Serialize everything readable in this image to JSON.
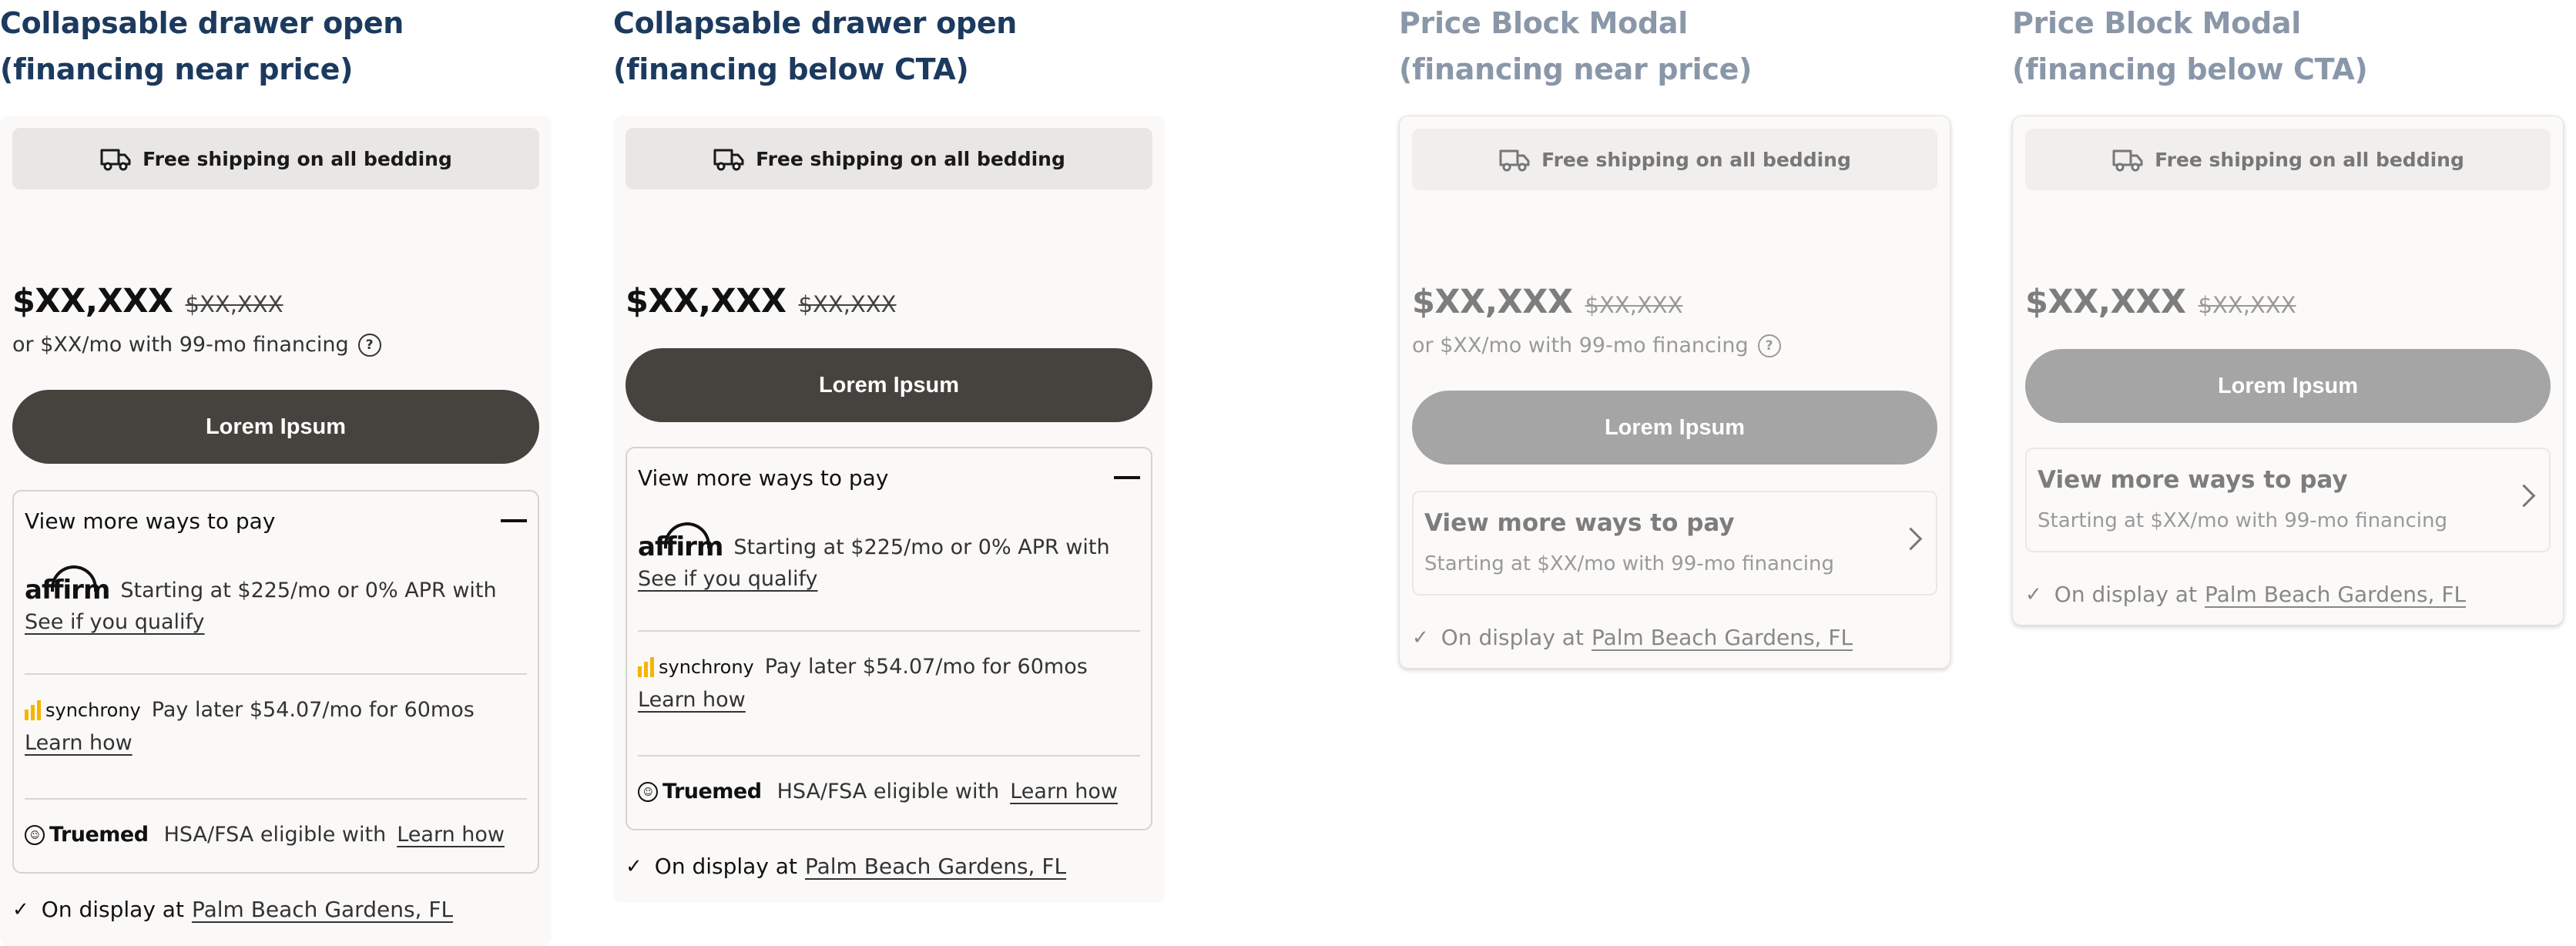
{
  "colors": {
    "title": "#1c3a5e",
    "title_dim": "#8a97a8",
    "cta": "#46433e",
    "cta_dim": "#a5a5a5",
    "synchrony_accent": "#f5b400"
  },
  "columns": [
    {
      "title": "Collapsable drawer open\n(financing near price)",
      "shipping": "Free shipping on all bedding",
      "price": "$XX,XXX",
      "price_old": "$XX,XXX",
      "financing": "or $XX/mo with 99-mo financing",
      "cta": "Lorem Ipsum",
      "drawer_title": "View more ways to pay",
      "affirm_text": "Starting at $225/mo or 0% APR with",
      "affirm_link": "See if you qualify",
      "affirm_logo": "affirm",
      "synchrony_logo": "synchrony",
      "synchrony_text": "Pay later $54.07/mo for 60mos",
      "synchrony_link": "Learn how",
      "truemed_logo": "Truemed",
      "truemed_text": "HSA/FSA eligible with",
      "truemed_link": "Learn how",
      "display_prefix": "On display at",
      "display_location": "Palm Beach Gardens, FL"
    },
    {
      "title": "Collapsable drawer open\n(financing below CTA)",
      "shipping": "Free shipping on all bedding",
      "price": "$XX,XXX",
      "price_old": "$XX,XXX",
      "cta": "Lorem Ipsum",
      "drawer_title": "View more ways to pay",
      "affirm_text": "Starting at $225/mo or 0% APR with",
      "affirm_link": "See if you qualify",
      "affirm_logo": "affirm",
      "synchrony_logo": "synchrony",
      "synchrony_text": "Pay later $54.07/mo for 60mos",
      "synchrony_link": "Learn how",
      "truemed_logo": "Truemed",
      "truemed_text": "HSA/FSA eligible with",
      "truemed_link": "Learn how",
      "display_prefix": "On display at",
      "display_location": "Palm Beach Gardens, FL"
    },
    {
      "title": "Price Block Modal\n(financing near price)",
      "shipping": "Free shipping on all bedding",
      "price": "$XX,XXX",
      "price_old": "$XX,XXX",
      "financing": "or $XX/mo with 99-mo financing",
      "cta": "Lorem Ipsum",
      "modal_title": "View more ways to pay",
      "modal_sub": "Starting at $XX/mo with 99-mo financing",
      "display_prefix": "On display at",
      "display_location": "Palm Beach Gardens, FL"
    },
    {
      "title": "Price Block Modal\n(financing below CTA)",
      "shipping": "Free shipping on all bedding",
      "price": "$XX,XXX",
      "price_old": "$XX,XXX",
      "cta": "Lorem Ipsum",
      "modal_title": "View more ways to pay",
      "modal_sub": "Starting at $XX/mo with 99-mo financing",
      "display_prefix": "On display at",
      "display_location": "Palm Beach Gardens, FL"
    }
  ]
}
